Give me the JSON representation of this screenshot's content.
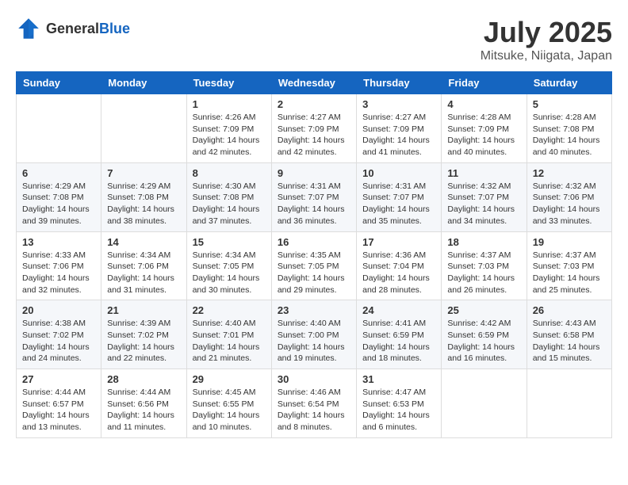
{
  "header": {
    "logo_general": "General",
    "logo_blue": "Blue",
    "month_year": "July 2025",
    "location": "Mitsuke, Niigata, Japan"
  },
  "days_of_week": [
    "Sunday",
    "Monday",
    "Tuesday",
    "Wednesday",
    "Thursday",
    "Friday",
    "Saturday"
  ],
  "weeks": [
    [
      null,
      null,
      {
        "day": "1",
        "sunrise": "Sunrise: 4:26 AM",
        "sunset": "Sunset: 7:09 PM",
        "daylight": "Daylight: 14 hours and 42 minutes."
      },
      {
        "day": "2",
        "sunrise": "Sunrise: 4:27 AM",
        "sunset": "Sunset: 7:09 PM",
        "daylight": "Daylight: 14 hours and 42 minutes."
      },
      {
        "day": "3",
        "sunrise": "Sunrise: 4:27 AM",
        "sunset": "Sunset: 7:09 PM",
        "daylight": "Daylight: 14 hours and 41 minutes."
      },
      {
        "day": "4",
        "sunrise": "Sunrise: 4:28 AM",
        "sunset": "Sunset: 7:09 PM",
        "daylight": "Daylight: 14 hours and 40 minutes."
      },
      {
        "day": "5",
        "sunrise": "Sunrise: 4:28 AM",
        "sunset": "Sunset: 7:08 PM",
        "daylight": "Daylight: 14 hours and 40 minutes."
      }
    ],
    [
      {
        "day": "6",
        "sunrise": "Sunrise: 4:29 AM",
        "sunset": "Sunset: 7:08 PM",
        "daylight": "Daylight: 14 hours and 39 minutes."
      },
      {
        "day": "7",
        "sunrise": "Sunrise: 4:29 AM",
        "sunset": "Sunset: 7:08 PM",
        "daylight": "Daylight: 14 hours and 38 minutes."
      },
      {
        "day": "8",
        "sunrise": "Sunrise: 4:30 AM",
        "sunset": "Sunset: 7:08 PM",
        "daylight": "Daylight: 14 hours and 37 minutes."
      },
      {
        "day": "9",
        "sunrise": "Sunrise: 4:31 AM",
        "sunset": "Sunset: 7:07 PM",
        "daylight": "Daylight: 14 hours and 36 minutes."
      },
      {
        "day": "10",
        "sunrise": "Sunrise: 4:31 AM",
        "sunset": "Sunset: 7:07 PM",
        "daylight": "Daylight: 14 hours and 35 minutes."
      },
      {
        "day": "11",
        "sunrise": "Sunrise: 4:32 AM",
        "sunset": "Sunset: 7:07 PM",
        "daylight": "Daylight: 14 hours and 34 minutes."
      },
      {
        "day": "12",
        "sunrise": "Sunrise: 4:32 AM",
        "sunset": "Sunset: 7:06 PM",
        "daylight": "Daylight: 14 hours and 33 minutes."
      }
    ],
    [
      {
        "day": "13",
        "sunrise": "Sunrise: 4:33 AM",
        "sunset": "Sunset: 7:06 PM",
        "daylight": "Daylight: 14 hours and 32 minutes."
      },
      {
        "day": "14",
        "sunrise": "Sunrise: 4:34 AM",
        "sunset": "Sunset: 7:06 PM",
        "daylight": "Daylight: 14 hours and 31 minutes."
      },
      {
        "day": "15",
        "sunrise": "Sunrise: 4:34 AM",
        "sunset": "Sunset: 7:05 PM",
        "daylight": "Daylight: 14 hours and 30 minutes."
      },
      {
        "day": "16",
        "sunrise": "Sunrise: 4:35 AM",
        "sunset": "Sunset: 7:05 PM",
        "daylight": "Daylight: 14 hours and 29 minutes."
      },
      {
        "day": "17",
        "sunrise": "Sunrise: 4:36 AM",
        "sunset": "Sunset: 7:04 PM",
        "daylight": "Daylight: 14 hours and 28 minutes."
      },
      {
        "day": "18",
        "sunrise": "Sunrise: 4:37 AM",
        "sunset": "Sunset: 7:03 PM",
        "daylight": "Daylight: 14 hours and 26 minutes."
      },
      {
        "day": "19",
        "sunrise": "Sunrise: 4:37 AM",
        "sunset": "Sunset: 7:03 PM",
        "daylight": "Daylight: 14 hours and 25 minutes."
      }
    ],
    [
      {
        "day": "20",
        "sunrise": "Sunrise: 4:38 AM",
        "sunset": "Sunset: 7:02 PM",
        "daylight": "Daylight: 14 hours and 24 minutes."
      },
      {
        "day": "21",
        "sunrise": "Sunrise: 4:39 AM",
        "sunset": "Sunset: 7:02 PM",
        "daylight": "Daylight: 14 hours and 22 minutes."
      },
      {
        "day": "22",
        "sunrise": "Sunrise: 4:40 AM",
        "sunset": "Sunset: 7:01 PM",
        "daylight": "Daylight: 14 hours and 21 minutes."
      },
      {
        "day": "23",
        "sunrise": "Sunrise: 4:40 AM",
        "sunset": "Sunset: 7:00 PM",
        "daylight": "Daylight: 14 hours and 19 minutes."
      },
      {
        "day": "24",
        "sunrise": "Sunrise: 4:41 AM",
        "sunset": "Sunset: 6:59 PM",
        "daylight": "Daylight: 14 hours and 18 minutes."
      },
      {
        "day": "25",
        "sunrise": "Sunrise: 4:42 AM",
        "sunset": "Sunset: 6:59 PM",
        "daylight": "Daylight: 14 hours and 16 minutes."
      },
      {
        "day": "26",
        "sunrise": "Sunrise: 4:43 AM",
        "sunset": "Sunset: 6:58 PM",
        "daylight": "Daylight: 14 hours and 15 minutes."
      }
    ],
    [
      {
        "day": "27",
        "sunrise": "Sunrise: 4:44 AM",
        "sunset": "Sunset: 6:57 PM",
        "daylight": "Daylight: 14 hours and 13 minutes."
      },
      {
        "day": "28",
        "sunrise": "Sunrise: 4:44 AM",
        "sunset": "Sunset: 6:56 PM",
        "daylight": "Daylight: 14 hours and 11 minutes."
      },
      {
        "day": "29",
        "sunrise": "Sunrise: 4:45 AM",
        "sunset": "Sunset: 6:55 PM",
        "daylight": "Daylight: 14 hours and 10 minutes."
      },
      {
        "day": "30",
        "sunrise": "Sunrise: 4:46 AM",
        "sunset": "Sunset: 6:54 PM",
        "daylight": "Daylight: 14 hours and 8 minutes."
      },
      {
        "day": "31",
        "sunrise": "Sunrise: 4:47 AM",
        "sunset": "Sunset: 6:53 PM",
        "daylight": "Daylight: 14 hours and 6 minutes."
      },
      null,
      null
    ]
  ]
}
